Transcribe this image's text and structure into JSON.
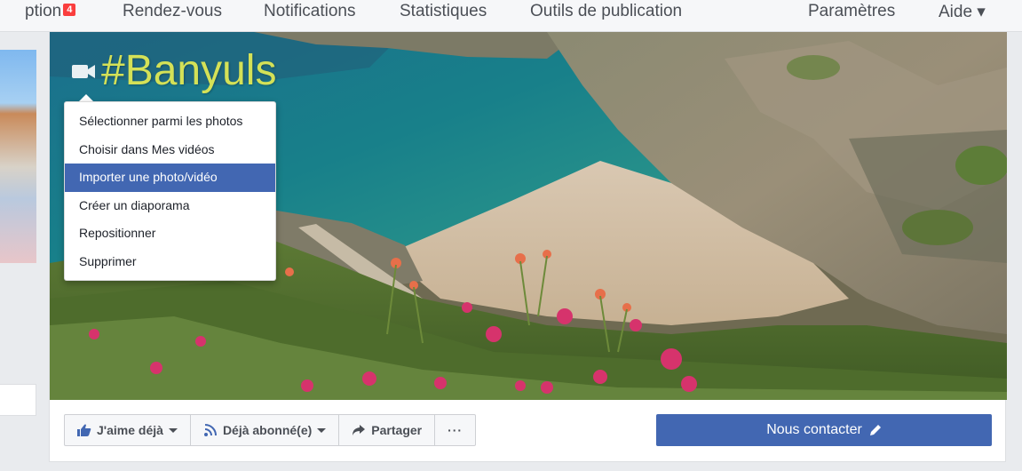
{
  "topnav": {
    "tabs": [
      {
        "label": "ption",
        "badge": "4"
      },
      {
        "label": "Rendez-vous"
      },
      {
        "label": "Notifications"
      },
      {
        "label": "Statistiques"
      },
      {
        "label": "Outils de publication"
      },
      {
        "label": "Paramètres"
      },
      {
        "label": "Aide ▾"
      }
    ]
  },
  "cover": {
    "hashtag": "#Banyuls",
    "menu": {
      "items": [
        "Sélectionner parmi les photos",
        "Choisir dans Mes vidéos",
        "Importer une photo/vidéo",
        "Créer un diaporama",
        "Repositionner",
        "Supprimer"
      ],
      "active_index": 2
    }
  },
  "actions": {
    "like": "J'aime déjà",
    "follow": "Déjà abonné(e)",
    "share": "Partager",
    "more": "···"
  },
  "contact": {
    "label": "Nous contacter"
  },
  "colors": {
    "accent": "#4267b2",
    "hashtag": "#d4e157",
    "badge": "#fa3e3e"
  }
}
